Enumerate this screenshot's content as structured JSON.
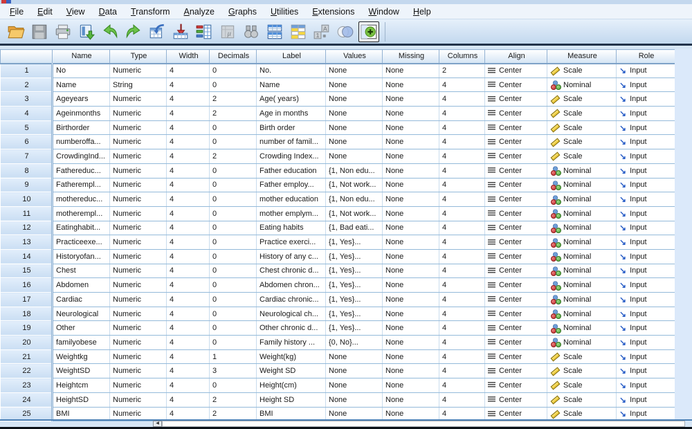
{
  "menu": {
    "items": [
      "File",
      "Edit",
      "View",
      "Data",
      "Transform",
      "Analyze",
      "Graphs",
      "Utilities",
      "Extensions",
      "Window",
      "Help"
    ]
  },
  "toolbar": {
    "icons": [
      "open-folder-icon",
      "save-icon",
      "print-icon",
      "recall-dialogs-icon",
      "undo-icon",
      "redo-icon",
      "goto-case-icon",
      "goto-variable-icon",
      "variables-icon",
      "descriptives-icon",
      "find-icon",
      "split-file-icon",
      "value-labels-icon",
      "use-variable-sets-icon",
      "show-all-variables-icon",
      "extensions-plus-icon"
    ]
  },
  "grid": {
    "columns": [
      "Name",
      "Type",
      "Width",
      "Decimals",
      "Label",
      "Values",
      "Missing",
      "Columns",
      "Align",
      "Measure",
      "Role"
    ],
    "rows": [
      {
        "num": "1",
        "name": "No",
        "type": "Numeric",
        "width": "4",
        "decimals": "0",
        "label": "No.",
        "values": "None",
        "missing": "None",
        "columns": "2",
        "align": "Center",
        "measure": "Scale",
        "role": "Input"
      },
      {
        "num": "2",
        "name": "Name",
        "type": "String",
        "width": "4",
        "decimals": "0",
        "label": "Name",
        "values": "None",
        "missing": "None",
        "columns": "4",
        "align": "Center",
        "measure": "Nominal",
        "role": "Input"
      },
      {
        "num": "3",
        "name": "Ageyears",
        "type": "Numeric",
        "width": "4",
        "decimals": "2",
        "label": "Age( years)",
        "values": "None",
        "missing": "None",
        "columns": "4",
        "align": "Center",
        "measure": "Scale",
        "role": "Input"
      },
      {
        "num": "4",
        "name": "Ageinmonths",
        "type": "Numeric",
        "width": "4",
        "decimals": "2",
        "label": "Age in months",
        "values": "None",
        "missing": "None",
        "columns": "4",
        "align": "Center",
        "measure": "Scale",
        "role": "Input"
      },
      {
        "num": "5",
        "name": "Birthorder",
        "type": "Numeric",
        "width": "4",
        "decimals": "0",
        "label": "Birth order",
        "values": "None",
        "missing": "None",
        "columns": "4",
        "align": "Center",
        "measure": "Scale",
        "role": "Input"
      },
      {
        "num": "6",
        "name": "numberoffa...",
        "type": "Numeric",
        "width": "4",
        "decimals": "0",
        "label": "number of famil...",
        "values": "None",
        "missing": "None",
        "columns": "4",
        "align": "Center",
        "measure": "Scale",
        "role": "Input"
      },
      {
        "num": "7",
        "name": "CrowdingInd...",
        "type": "Numeric",
        "width": "4",
        "decimals": "2",
        "label": "Crowding Index...",
        "values": "None",
        "missing": "None",
        "columns": "4",
        "align": "Center",
        "measure": "Scale",
        "role": "Input"
      },
      {
        "num": "8",
        "name": "Fathereduc...",
        "type": "Numeric",
        "width": "4",
        "decimals": "0",
        "label": "Father education",
        "values": "{1, Non edu...",
        "missing": "None",
        "columns": "4",
        "align": "Center",
        "measure": "Nominal",
        "role": "Input"
      },
      {
        "num": "9",
        "name": "Fatherempl...",
        "type": "Numeric",
        "width": "4",
        "decimals": "0",
        "label": "Father employ...",
        "values": "{1, Not work...",
        "missing": "None",
        "columns": "4",
        "align": "Center",
        "measure": "Nominal",
        "role": "Input"
      },
      {
        "num": "10",
        "name": "mothereduc...",
        "type": "Numeric",
        "width": "4",
        "decimals": "0",
        "label": "mother education",
        "values": "{1, Non edu...",
        "missing": "None",
        "columns": "4",
        "align": "Center",
        "measure": "Nominal",
        "role": "Input"
      },
      {
        "num": "11",
        "name": "motherempl...",
        "type": "Numeric",
        "width": "4",
        "decimals": "0",
        "label": "mother emplym...",
        "values": "{1, Not work...",
        "missing": "None",
        "columns": "4",
        "align": "Center",
        "measure": "Nominal",
        "role": "Input"
      },
      {
        "num": "12",
        "name": "Eatinghabit...",
        "type": "Numeric",
        "width": "4",
        "decimals": "0",
        "label": "Eating habits",
        "values": "{1, Bad eati...",
        "missing": "None",
        "columns": "4",
        "align": "Center",
        "measure": "Nominal",
        "role": "Input"
      },
      {
        "num": "13",
        "name": "Practiceexe...",
        "type": "Numeric",
        "width": "4",
        "decimals": "0",
        "label": "Practice exerci...",
        "values": "{1, Yes}...",
        "missing": "None",
        "columns": "4",
        "align": "Center",
        "measure": "Nominal",
        "role": "Input"
      },
      {
        "num": "14",
        "name": "Historyofan...",
        "type": "Numeric",
        "width": "4",
        "decimals": "0",
        "label": "History of any c...",
        "values": "{1, Yes}...",
        "missing": "None",
        "columns": "4",
        "align": "Center",
        "measure": "Nominal",
        "role": "Input"
      },
      {
        "num": "15",
        "name": "Chest",
        "type": "Numeric",
        "width": "4",
        "decimals": "0",
        "label": "Chest chronic d...",
        "values": "{1, Yes}...",
        "missing": "None",
        "columns": "4",
        "align": "Center",
        "measure": "Nominal",
        "role": "Input"
      },
      {
        "num": "16",
        "name": "Abdomen",
        "type": "Numeric",
        "width": "4",
        "decimals": "0",
        "label": "Abdomen chron...",
        "values": "{1, Yes}...",
        "missing": "None",
        "columns": "4",
        "align": "Center",
        "measure": "Nominal",
        "role": "Input"
      },
      {
        "num": "17",
        "name": "Cardiac",
        "type": "Numeric",
        "width": "4",
        "decimals": "0",
        "label": "Cardiac chronic...",
        "values": "{1, Yes}...",
        "missing": "None",
        "columns": "4",
        "align": "Center",
        "measure": "Nominal",
        "role": "Input"
      },
      {
        "num": "18",
        "name": "Neurological",
        "type": "Numeric",
        "width": "4",
        "decimals": "0",
        "label": "Neurological ch...",
        "values": "{1, Yes}...",
        "missing": "None",
        "columns": "4",
        "align": "Center",
        "measure": "Nominal",
        "role": "Input"
      },
      {
        "num": "19",
        "name": "Other",
        "type": "Numeric",
        "width": "4",
        "decimals": "0",
        "label": "Other chronic d...",
        "values": "{1, Yes}...",
        "missing": "None",
        "columns": "4",
        "align": "Center",
        "measure": "Nominal",
        "role": "Input"
      },
      {
        "num": "20",
        "name": "familyobese",
        "type": "Numeric",
        "width": "4",
        "decimals": "0",
        "label": "Family history ...",
        "values": "{0, No}...",
        "missing": "None",
        "columns": "4",
        "align": "Center",
        "measure": "Nominal",
        "role": "Input"
      },
      {
        "num": "21",
        "name": "Weightkg",
        "type": "Numeric",
        "width": "4",
        "decimals": "1",
        "label": "Weight(kg)",
        "values": "None",
        "missing": "None",
        "columns": "4",
        "align": "Center",
        "measure": "Scale",
        "role": "Input"
      },
      {
        "num": "22",
        "name": "WeightSD",
        "type": "Numeric",
        "width": "4",
        "decimals": "3",
        "label": "Weight SD",
        "values": "None",
        "missing": "None",
        "columns": "4",
        "align": "Center",
        "measure": "Scale",
        "role": "Input"
      },
      {
        "num": "23",
        "name": "Heightcm",
        "type": "Numeric",
        "width": "4",
        "decimals": "0",
        "label": "Height(cm)",
        "values": "None",
        "missing": "None",
        "columns": "4",
        "align": "Center",
        "measure": "Scale",
        "role": "Input"
      },
      {
        "num": "24",
        "name": "HeightSD",
        "type": "Numeric",
        "width": "4",
        "decimals": "2",
        "label": "Height SD",
        "values": "None",
        "missing": "None",
        "columns": "4",
        "align": "Center",
        "measure": "Scale",
        "role": "Input"
      },
      {
        "num": "25",
        "name": "BMI",
        "type": "Numeric",
        "width": "4",
        "decimals": "2",
        "label": "BMI",
        "values": "None",
        "missing": "None",
        "columns": "4",
        "align": "Center",
        "measure": "Scale",
        "role": "Input"
      }
    ]
  },
  "scrollbar": {
    "left_arrow": "◀"
  },
  "colors": {
    "accent_blue": "#2b5fc7",
    "scale_icon_yellow": "#e8bf2a",
    "nominal_red": "#c22525",
    "nominal_blue": "#6f9fd8",
    "nominal_green": "#4ba032",
    "toolbar_bg": "#c2d8ee",
    "row_header_bg": "#cadef3",
    "grid_line": "#94bada"
  }
}
